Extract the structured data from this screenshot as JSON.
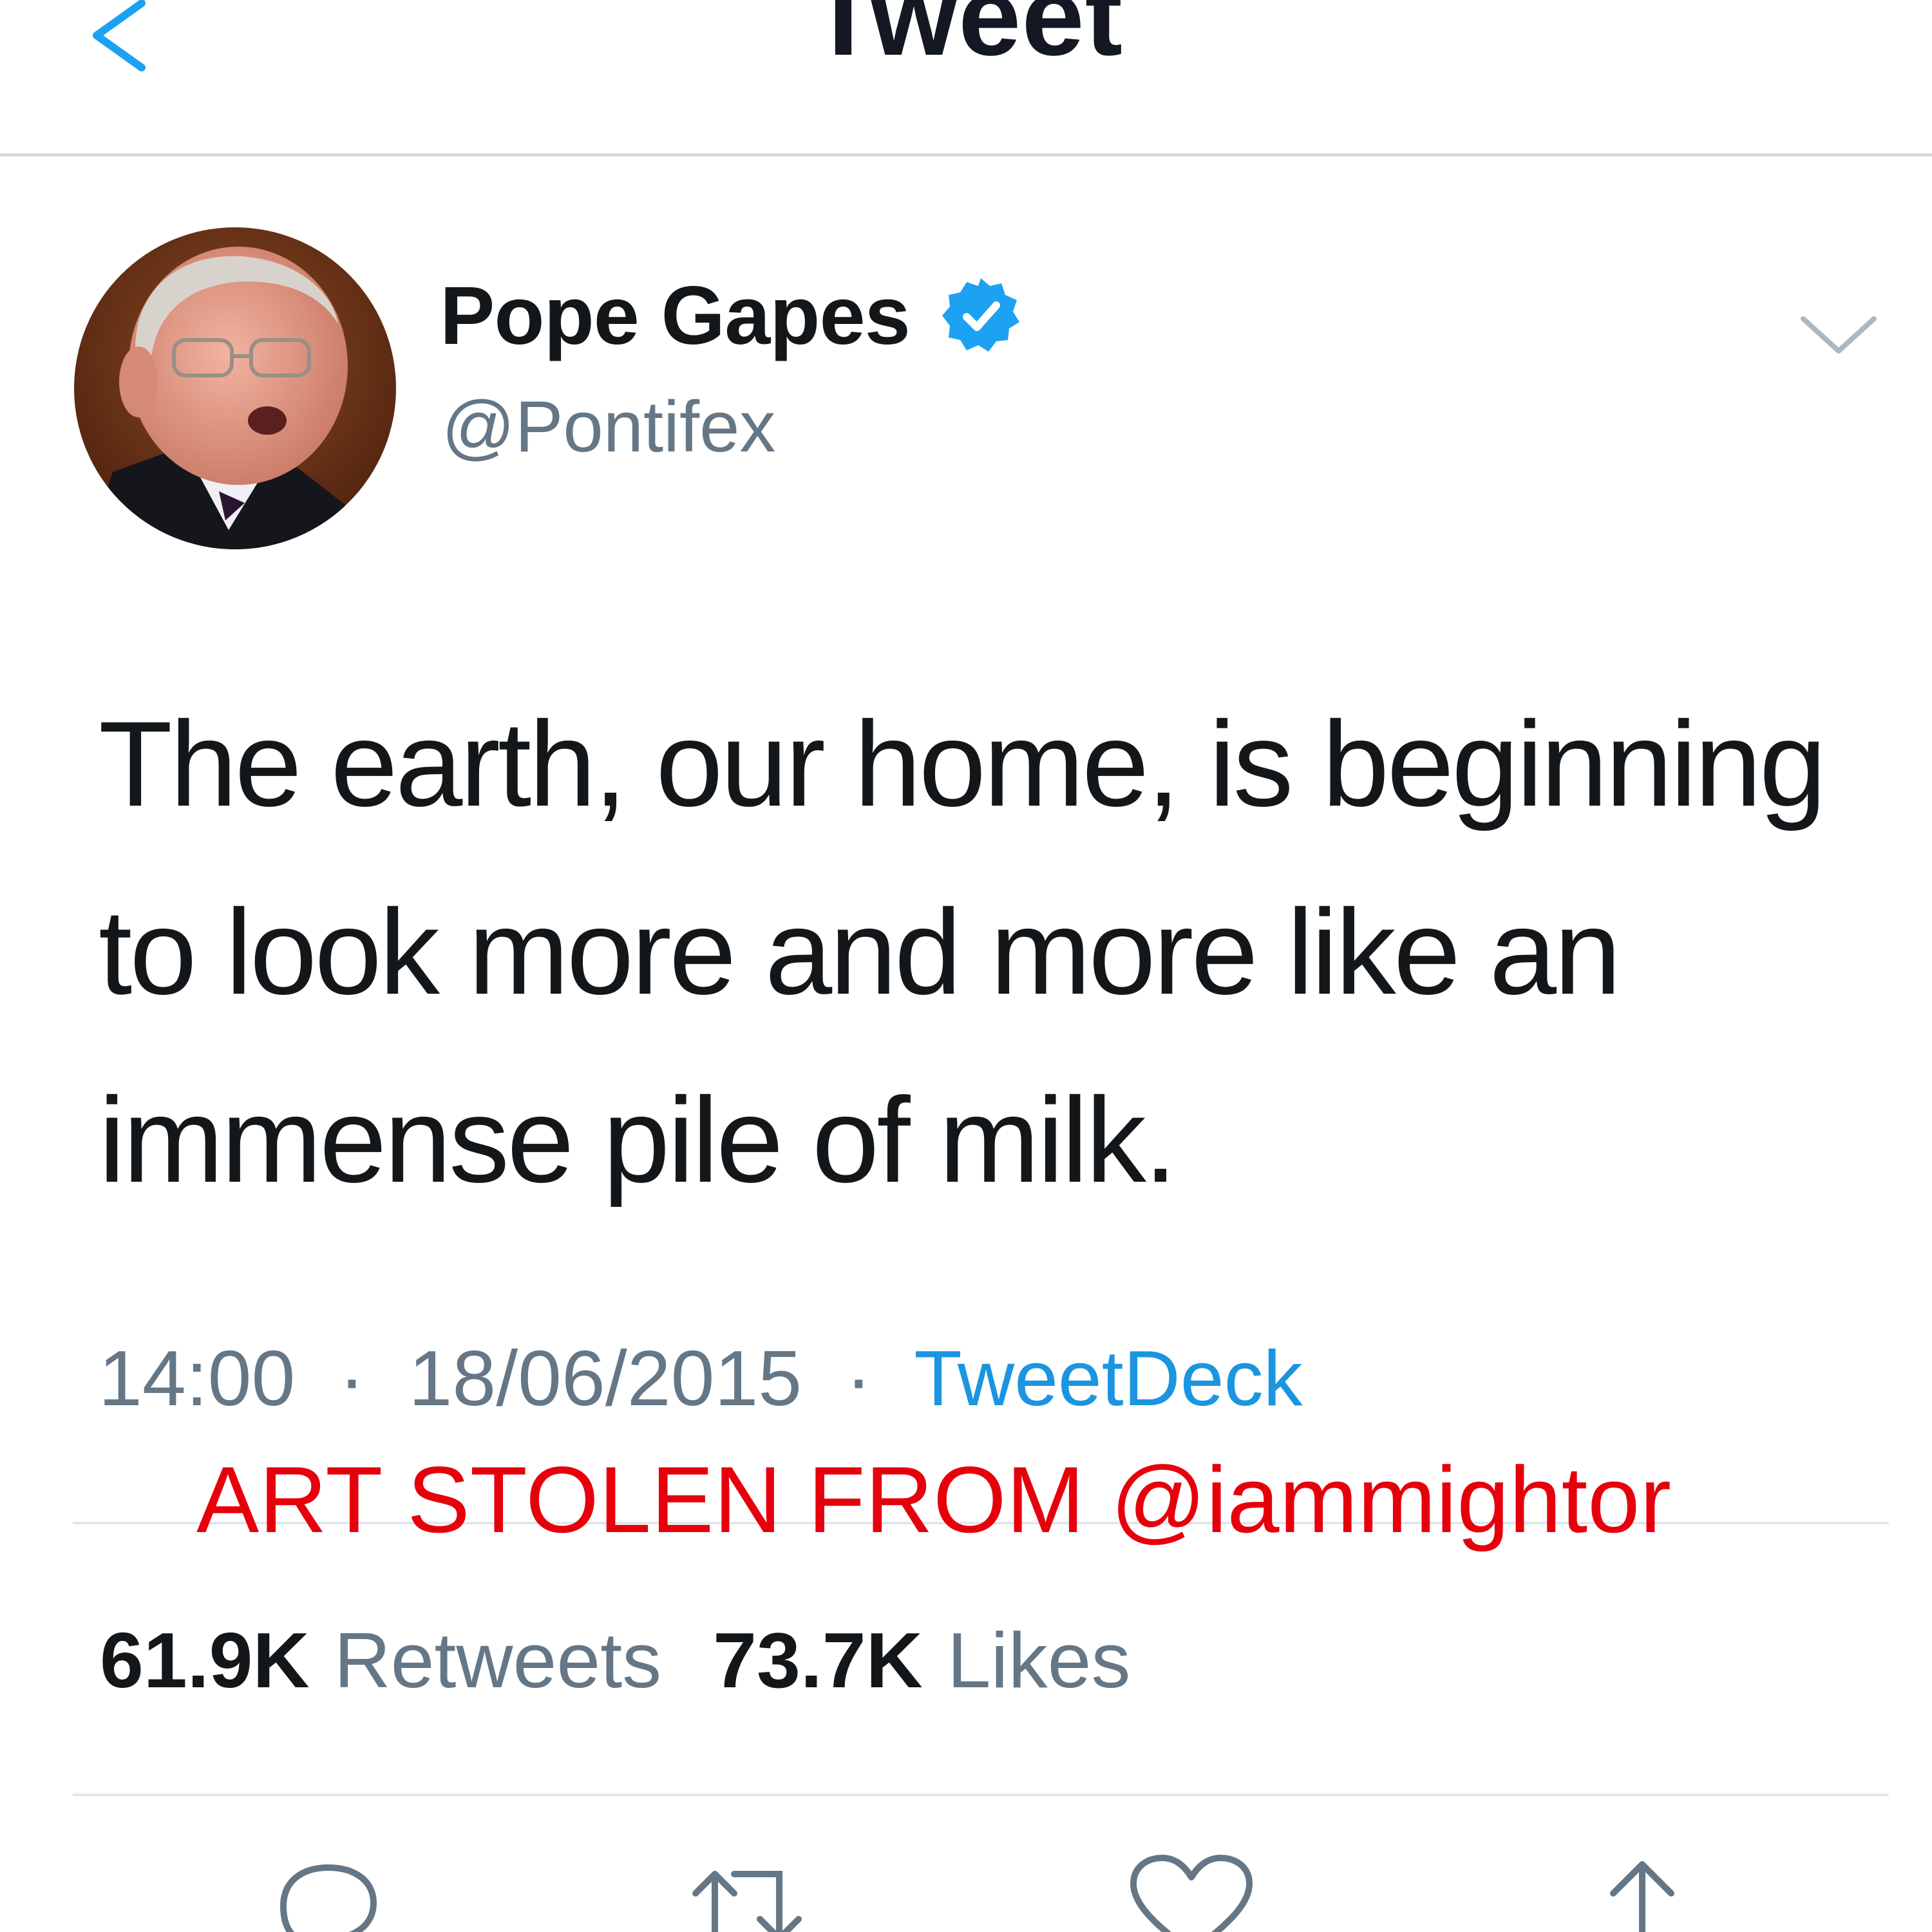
{
  "header": {
    "title": "Tweet",
    "back_icon": "chevron-left-icon"
  },
  "author": {
    "display_name": "Pope Gapes",
    "handle": "@Pontifex",
    "verified": true,
    "accent_color": "#1da1f2"
  },
  "tweet": {
    "text_lines": [
      "The earth, our home, is beginning",
      "to look more and more like an",
      "immense pile of milk."
    ],
    "time": "14:00",
    "date": "18/06/2015",
    "separator": "·",
    "source": "TweetDeck"
  },
  "watermark": {
    "text": "ART STOLEN FROM @iammightor",
    "color": "#e6000c"
  },
  "stats": {
    "retweets_count": "61.9K",
    "retweets_label": "Retweets",
    "likes_count": "73.7K",
    "likes_label": "Likes"
  },
  "actions": [
    "reply-icon",
    "retweet-icon",
    "like-icon",
    "share-icon"
  ]
}
